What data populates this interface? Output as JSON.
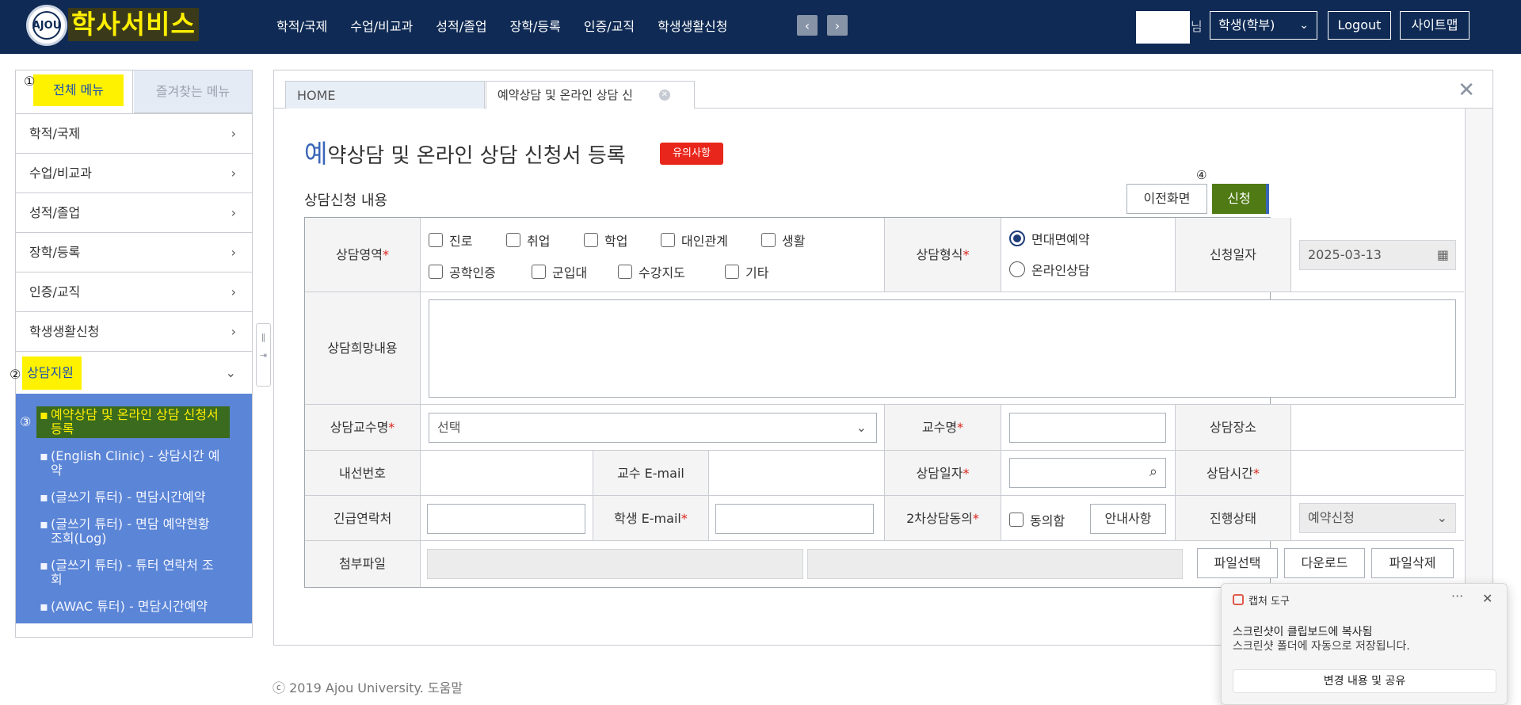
{
  "header": {
    "brand": "학사서비스",
    "logo_text": "AJOU",
    "nav": [
      "학적/국제",
      "수업/비교과",
      "성적/졸업",
      "장학/등록",
      "인증/교직",
      "학생생활신청"
    ],
    "prev_arrow": "‹",
    "next_arrow": "›",
    "name_suffix": "님",
    "role_select": "학생(학부)",
    "logout": "Logout",
    "sitemap": "사이트맵"
  },
  "sidebar": {
    "tab_all": "전체 메뉴",
    "tab_fav": "즐겨찾는 메뉴",
    "markers": [
      "①",
      "②",
      "③"
    ],
    "items": [
      {
        "label": "학적/국제"
      },
      {
        "label": "수업/비교과"
      },
      {
        "label": "성적/졸업"
      },
      {
        "label": "장학/등록"
      },
      {
        "label": "인증/교직"
      },
      {
        "label": "학생생활신청"
      },
      {
        "label": "상담지원"
      }
    ],
    "submenu": [
      "예약상담 및 온라인 상담 신청서 등록",
      "(English Clinic) - 상담시간 예약",
      "(글쓰기 튜터) - 면담시간예약",
      "(글쓰기 튜터) - 면담 예약현황 조회(Log)",
      "(글쓰기 튜터) - 튜터 연락처 조회",
      "(AWAC 튜터) - 면담시간예약"
    ]
  },
  "tabs": {
    "home": "HOME",
    "active": "예약상담 및 온라인 상담 신"
  },
  "page": {
    "title_first": "예",
    "title_rest": "약상담 및 온라인 상담 신청서 등록",
    "notice_badge": "유의사항",
    "section_title": "상담신청 내용",
    "prev_button": "이전화면",
    "apply_button": "신청",
    "marker4": "④"
  },
  "form": {
    "area_label": "상담영역",
    "areas_row1": [
      "진로",
      "취업",
      "학업",
      "대인관계",
      "생활"
    ],
    "areas_row2": [
      "공학인증",
      "군입대",
      "수강지도",
      "기타"
    ],
    "type_label": "상담형식",
    "type_options": [
      "면대면예약",
      "온라인상담"
    ],
    "type_selected": "면대면예약",
    "date_label": "신청일자",
    "date_value": "2025-03-13",
    "wish_label": "상담희망내용",
    "prof_label": "상담교수명",
    "prof_select": "선택",
    "prof_name_label": "교수명",
    "place_label": "상담장소",
    "ext_label": "내선번호",
    "prof_email_label": "교수 E-mail",
    "consult_date_label": "상담일자",
    "consult_time_label": "상담시간",
    "emergency_label": "긴급연락처",
    "student_email_label": "학생 E-mail",
    "second_consent_label": "2차상담동의",
    "agree_label": "동의함",
    "guide_button": "안내사항",
    "status_label": "진행상태",
    "status_value": "예약신청",
    "attach_label": "첨부파일",
    "file_select": "파일선택",
    "download": "다운로드",
    "file_delete": "파일삭제",
    "required_mark": "*"
  },
  "footer": "ⓒ 2019 Ajou University. 도움말",
  "toast": {
    "app": "캡처 도구",
    "dots": "···",
    "close": "✕",
    "msg1": "스크린샷이 클립보드에 복사됨",
    "msg2": "스크린샷 폴더에 자동으로 저장됩니다.",
    "share": "변경 내용 및 공유"
  }
}
